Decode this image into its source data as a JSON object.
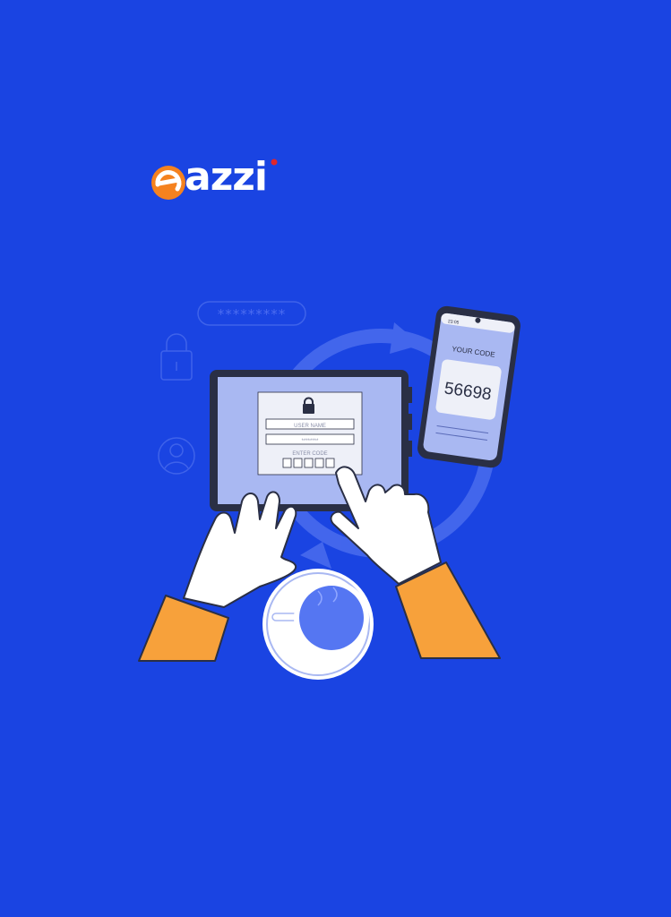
{
  "brand": {
    "logo_letter": "e",
    "logo_text": "azzi",
    "colors": {
      "background": "#1a44e2",
      "accent": "#f5821f",
      "dot": "#e0262b"
    }
  },
  "illustration": {
    "password_mask": "*********",
    "login_form": {
      "username_placeholder": "USER NAME",
      "password_placeholder": "********",
      "code_label": "ENTER CODE"
    },
    "phone": {
      "status_time": "23:05",
      "code_label": "YOUR CODE",
      "code_value": "56698"
    },
    "icons": [
      "padlock-icon",
      "user-icon",
      "sync-arrows-icon",
      "lock-icon"
    ]
  }
}
